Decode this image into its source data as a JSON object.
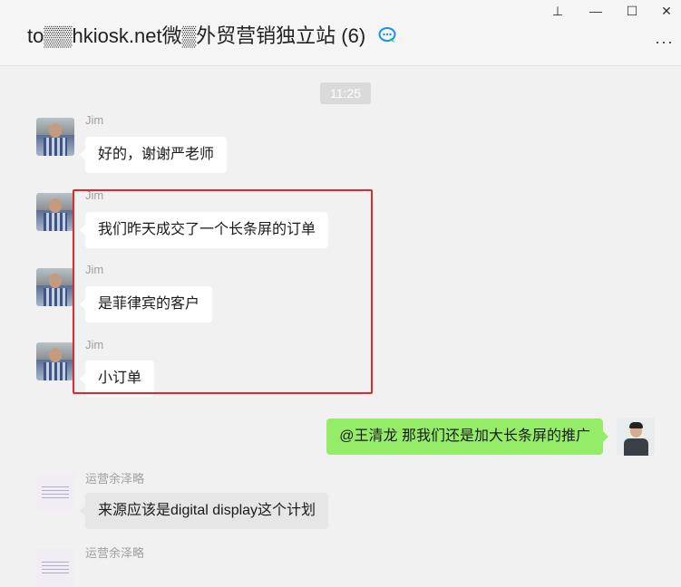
{
  "window": {
    "title": "to▒▒hkiosk.net微▒外贸营销独立站 (6)",
    "controls": {
      "pin": "⊥",
      "minimize": "—",
      "maximize": "☐",
      "close": "✕"
    },
    "more": "···"
  },
  "chat": {
    "timestamp": "11:25",
    "messages": [
      {
        "sender": "Jim",
        "text": "好的，谢谢严老师"
      },
      {
        "sender": "Jim",
        "text": "我们昨天成交了一个长条屏的订单"
      },
      {
        "sender": "Jim",
        "text": "是菲律宾的客户"
      },
      {
        "sender": "Jim",
        "text": "小订单"
      },
      {
        "sender": "",
        "text": "@王清龙 那我们还是加大长条屏的推广"
      },
      {
        "sender": "运营余泽略",
        "text": "来源应该是digital display这个计划"
      },
      {
        "sender": "运营余泽略",
        "text": ""
      }
    ]
  },
  "colors": {
    "background": "#f1f1f1",
    "self_bubble": "#95ec69",
    "highlight_border": "#e3262a",
    "chat_icon": "#1e8fe6"
  },
  "icons": {
    "chat_bubble": "chat-bubble-icon",
    "pin": "pin-icon",
    "minimize": "minimize-icon",
    "maximize": "maximize-icon",
    "close": "close-icon",
    "more": "more-icon"
  }
}
